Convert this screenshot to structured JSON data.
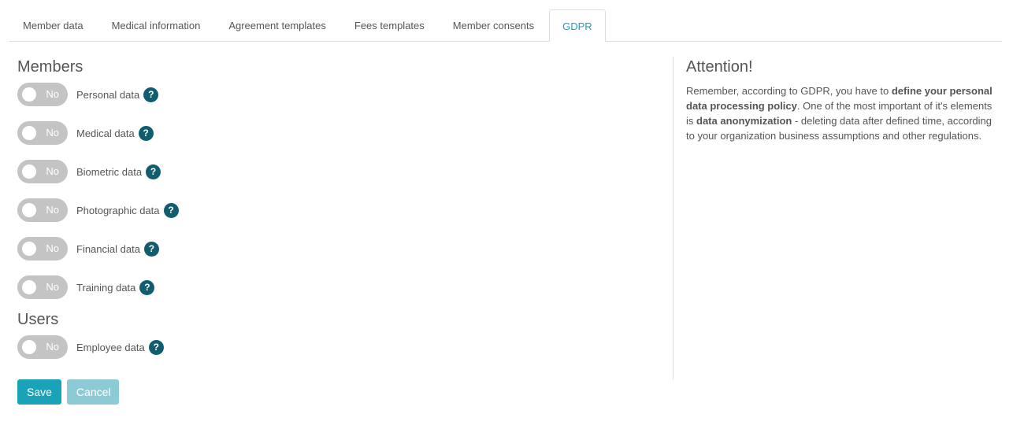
{
  "tabs": [
    {
      "label": "Member data",
      "active": false
    },
    {
      "label": "Medical information",
      "active": false
    },
    {
      "label": "Agreement templates",
      "active": false
    },
    {
      "label": "Fees templates",
      "active": false
    },
    {
      "label": "Member consents",
      "active": false
    },
    {
      "label": "GDPR",
      "active": true
    }
  ],
  "members": {
    "title": "Members",
    "items": [
      {
        "label": "Personal data",
        "state": "No"
      },
      {
        "label": "Medical data",
        "state": "No"
      },
      {
        "label": "Biometric data",
        "state": "No"
      },
      {
        "label": "Photographic data",
        "state": "No"
      },
      {
        "label": "Financial data",
        "state": "No"
      },
      {
        "label": "Training data",
        "state": "No"
      }
    ]
  },
  "users": {
    "title": "Users",
    "items": [
      {
        "label": "Employee data",
        "state": "No"
      }
    ]
  },
  "help_glyph": "?",
  "buttons": {
    "save": "Save",
    "cancel": "Cancel"
  },
  "attention": {
    "title": "Attention!",
    "text_1": "Remember, according to GDPR, you have to ",
    "bold_1": "define your personal data processing policy",
    "text_2": ". One of the most important of it's elements is ",
    "bold_2": "data anonymization",
    "text_3": " - deleting data after defined time, according to your organization business assumptions and other regulations."
  },
  "colors": {
    "accent": "#1aa3b8",
    "help_icon": "#0f5d6e",
    "toggle_off": "#c4c4c4",
    "cancel": "#8ccbd6"
  }
}
